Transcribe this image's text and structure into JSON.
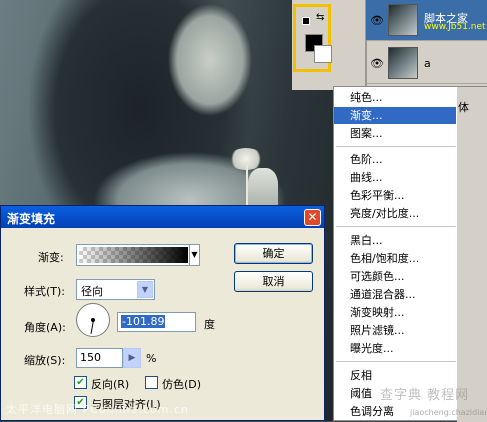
{
  "layers": {
    "top_layer_name": "脚本之家",
    "top_layer_url": "www.Jb51.net",
    "second_layer_name": "a",
    "fill_label_fragment": "体"
  },
  "context_menu": {
    "items": [
      "纯色...",
      "渐变...",
      "图案...",
      "色阶...",
      "曲线...",
      "色彩平衡...",
      "亮度/对比度...",
      "黑白...",
      "色相/饱和度...",
      "可选颜色...",
      "通道混合器...",
      "渐变映射...",
      "照片滤镜...",
      "曝光度...",
      "反相",
      "阈值",
      "色调分离"
    ],
    "selected": "渐变..."
  },
  "dialog": {
    "title": "渐变填充",
    "gradient_label": "渐变:",
    "style_label": "样式(T):",
    "style_value": "径向",
    "angle_label": "角度(A):",
    "angle_value": "-101.89",
    "angle_unit": "度",
    "scale_label": "缩放(S):",
    "scale_value": "150",
    "scale_unit": "%",
    "reverse_label": "反向(R)",
    "reverse_checked": true,
    "dither_label": "仿色(D)",
    "dither_checked": false,
    "align_label": "与图层对齐(L)",
    "align_checked": true,
    "ok_label": "确定",
    "cancel_label": "取消"
  },
  "watermark": {
    "bottom_left": "太平洋电脑网 PConline.com.cn",
    "bottom_right": "查字典 教程网",
    "bottom_right_url": "jiaocheng.chazidian.com"
  }
}
